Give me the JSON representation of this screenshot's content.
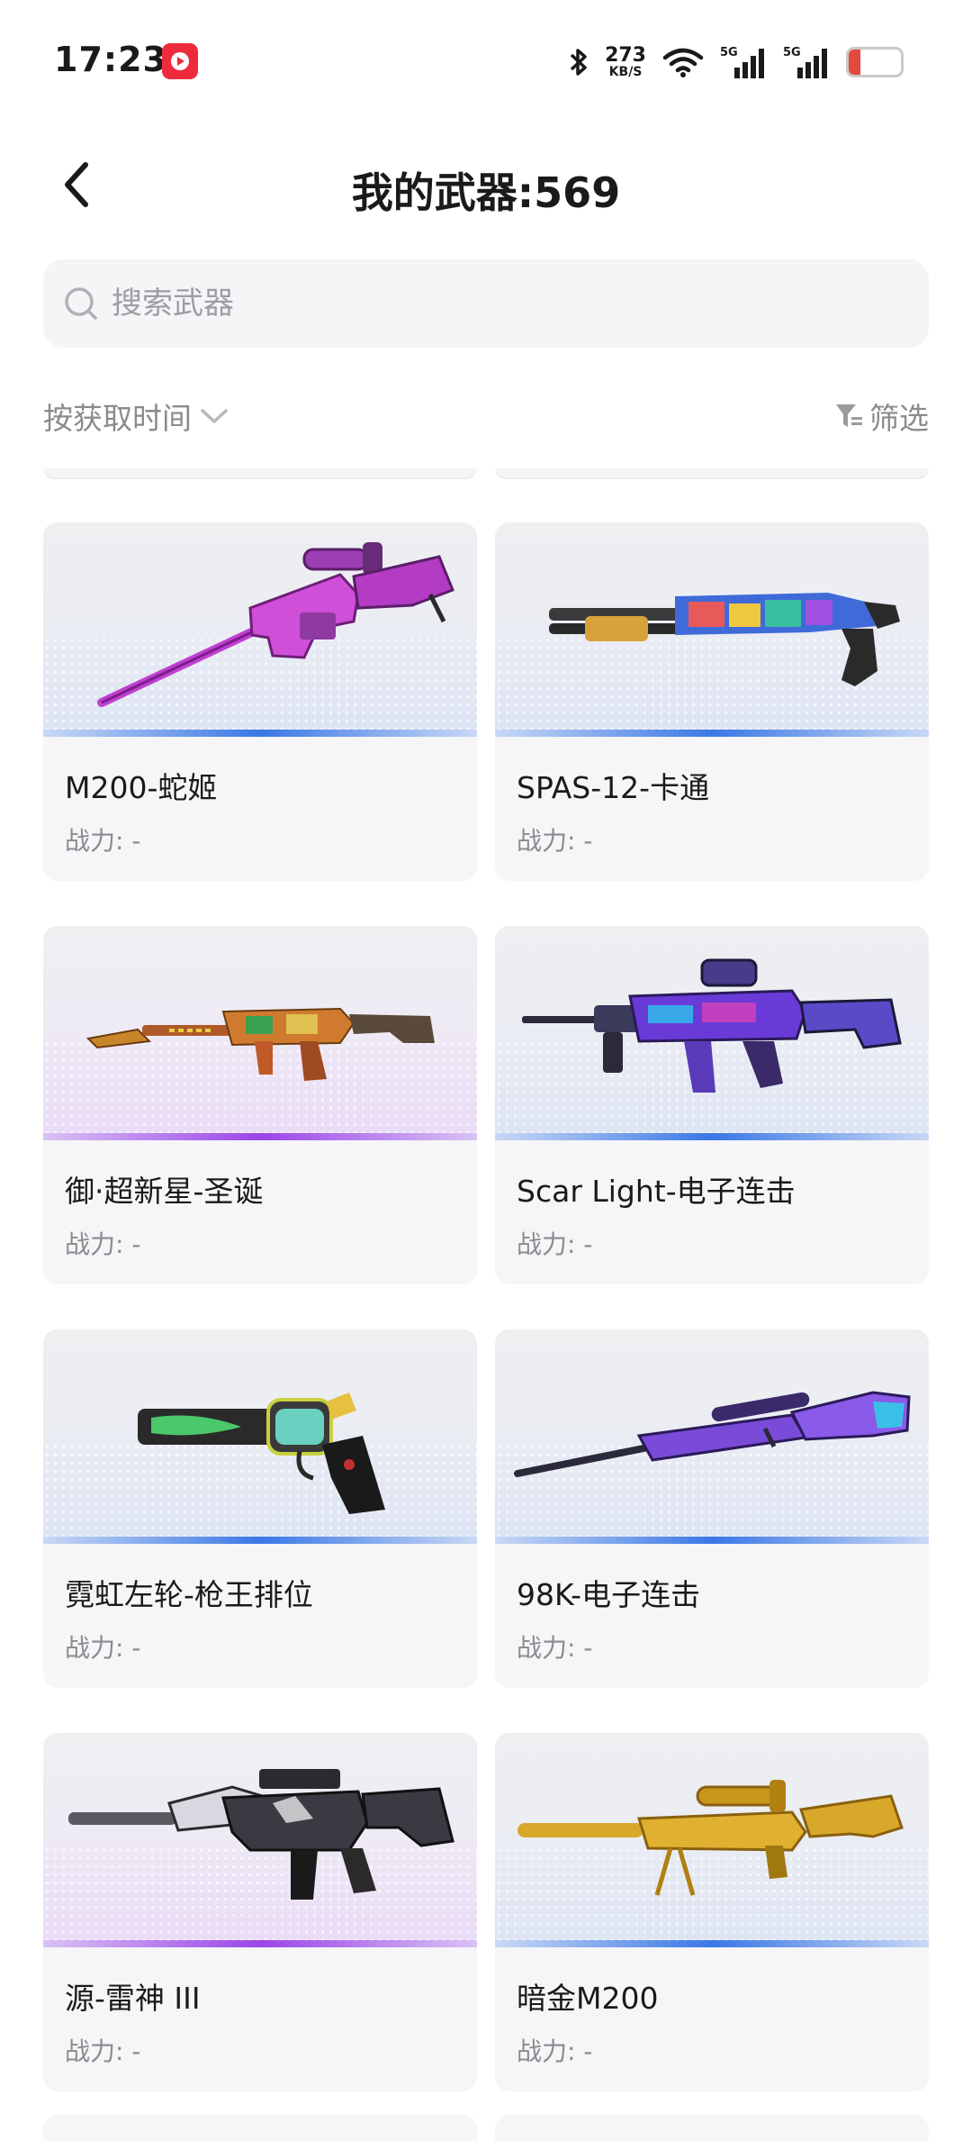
{
  "status_bar": {
    "time": "17:23",
    "app_icon": "video-app-icon",
    "bluetooth_icon": "bluetooth-icon",
    "speed_value": "273",
    "speed_unit": "KB/S",
    "wifi_icon": "wifi-icon",
    "signal1_label": "5G",
    "signal2_label": "5G",
    "battery_level": "15",
    "battery_color": "#e5483f"
  },
  "header": {
    "back_icon": "chevron-left-icon",
    "title": "我的武器:569"
  },
  "search": {
    "placeholder": "搜索武器",
    "value": "",
    "icon": "search-icon"
  },
  "sort": {
    "label": "按获取时间",
    "icon": "chevron-down-icon"
  },
  "filter": {
    "label": "筛选",
    "icon": "filter-icon"
  },
  "weapons": [
    {
      "name": "M200-蛇姬",
      "power_label": "战力: -",
      "theme": "blue",
      "image": "sniper-rifle-pink"
    },
    {
      "name": "SPAS-12-卡通",
      "power_label": "战力: -",
      "theme": "blue",
      "image": "shotgun-cartoon"
    },
    {
      "name": "御·超新星-圣诞",
      "power_label": "战力: -",
      "theme": "purple",
      "image": "rifle-christmas"
    },
    {
      "name": "Scar Light-电子连击",
      "power_label": "战力: -",
      "theme": "blue",
      "image": "assault-rifle-electric"
    },
    {
      "name": "霓虹左轮-枪王排位",
      "power_label": "战力: -",
      "theme": "blue",
      "image": "revolver-neon"
    },
    {
      "name": "98K-电子连击",
      "power_label": "战力: -",
      "theme": "blue",
      "image": "bolt-rifle-electric"
    },
    {
      "name": "源-雷神 III",
      "power_label": "战力: -",
      "theme": "purple",
      "image": "carbine-thunder"
    },
    {
      "name": "暗金M200",
      "power_label": "战力: -",
      "theme": "blue",
      "image": "sniper-rifle-gold"
    }
  ]
}
